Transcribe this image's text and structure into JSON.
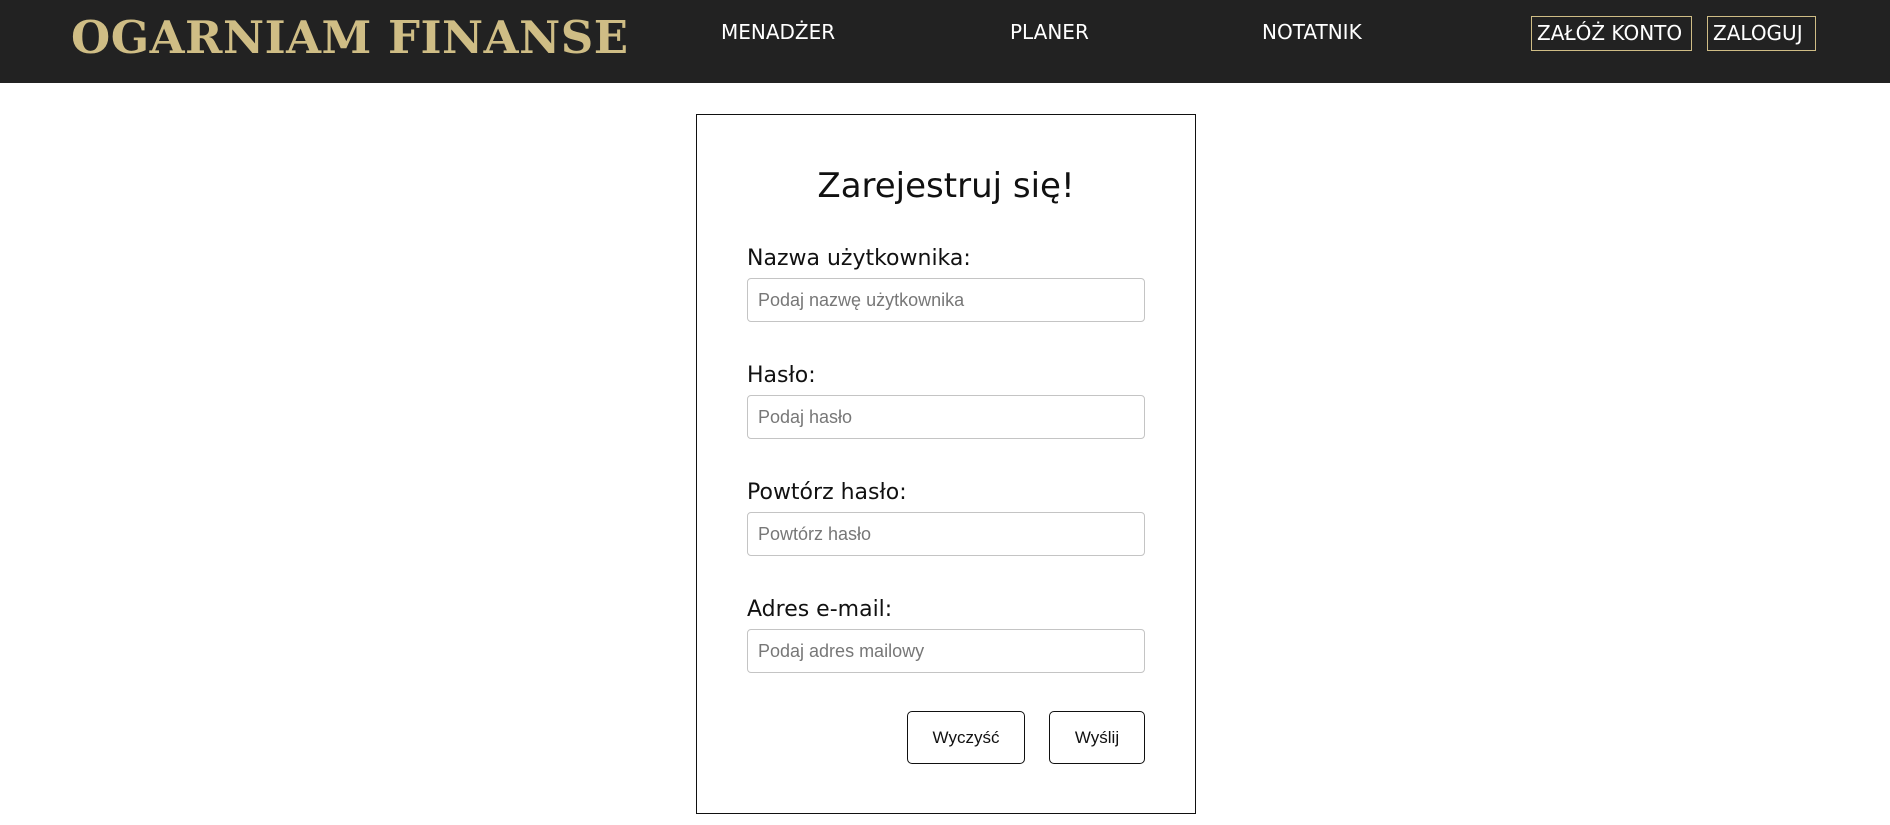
{
  "header": {
    "logo": "OGARNIAM FINANSE",
    "nav": {
      "menedzer": "MENADŻER",
      "planer": "PLANER",
      "notatnik": "NOTATNIK"
    },
    "auth": {
      "register": "ZAŁÓŻ KONTO",
      "login": "ZALOGUJ"
    }
  },
  "form": {
    "title": "Zarejestruj się!",
    "username": {
      "label": "Nazwa użytkownika:",
      "placeholder": "Podaj nazwę użytkownika",
      "value": ""
    },
    "password": {
      "label": "Hasło:",
      "placeholder": "Podaj hasło",
      "value": ""
    },
    "repeat_password": {
      "label": "Powtórz hasło:",
      "placeholder": "Powtórz hasło",
      "value": ""
    },
    "email": {
      "label": "Adres e-mail:",
      "placeholder": "Podaj adres mailowy",
      "value": ""
    },
    "buttons": {
      "clear": "Wyczyść",
      "send": "Wyślij"
    }
  },
  "colors": {
    "header_bg": "#222222",
    "accent_gold": "#cfbd85",
    "text_dark": "#111111"
  }
}
